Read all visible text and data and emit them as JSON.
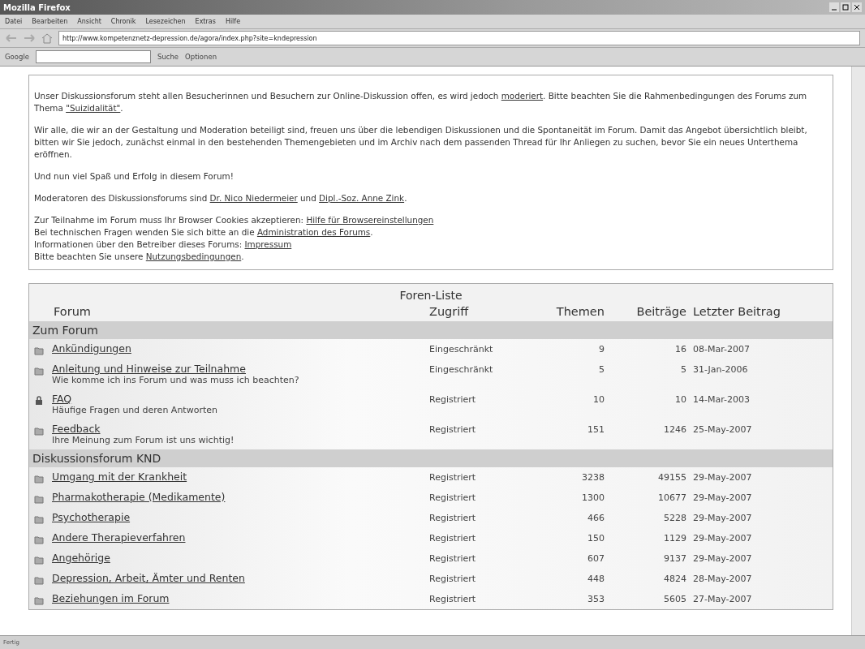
{
  "window": {
    "title": "Mozilla Firefox"
  },
  "menu": [
    "Datei",
    "Bearbeiten",
    "Ansicht",
    "Chronik",
    "Lesezeichen",
    "Extras",
    "Hilfe"
  ],
  "address": {
    "value": "http://www.kompetenznetz-depression.de/agora/index.php?site=kndepression"
  },
  "google_toolbar": {
    "brand": "Google",
    "search": "Suche",
    "options": "Optionen"
  },
  "intro": [
    [
      {
        "kind": "text",
        "text": "Unser Diskussionsforum steht allen Besucherinnen und Besuchern zur Online-Diskussion offen, es wird jedoch "
      },
      {
        "kind": "link",
        "text": "moderiert"
      },
      {
        "kind": "text",
        "text": ". Bitte beachten Sie die Rahmenbedingungen des Forums zum Thema "
      },
      {
        "kind": "link",
        "text": "\"Suizidalität\""
      },
      {
        "kind": "text",
        "text": "."
      }
    ],
    [
      {
        "kind": "text",
        "text": "Wir alle, die wir an der Gestaltung und Moderation beteiligt sind, freuen uns über die lebendigen Diskussionen und die Spontaneität im Forum. Damit das Angebot übersichtlich bleibt, bitten wir Sie jedoch, zunächst einmal in den bestehenden Themengebieten und im Archiv nach dem passenden Thread für Ihr Anliegen zu suchen, bevor Sie ein neues Unterthema eröffnen."
      }
    ],
    [
      {
        "kind": "text",
        "text": "Und nun viel Spaß und Erfolg in diesem Forum!"
      }
    ],
    [
      {
        "kind": "text",
        "text": "Moderatoren des Diskussionsforums sind "
      },
      {
        "kind": "link",
        "text": "Dr. Nico Niedermeier"
      },
      {
        "kind": "text",
        "text": " und "
      },
      {
        "kind": "link",
        "text": "Dipl.-Soz. Anne Zink"
      },
      {
        "kind": "text",
        "text": "."
      }
    ]
  ],
  "info_lines": [
    [
      {
        "kind": "text",
        "text": "Zur Teilnahme im Forum muss Ihr Browser Cookies akzeptieren: "
      },
      {
        "kind": "link",
        "text": "Hilfe für Browsereinstellungen"
      }
    ],
    [
      {
        "kind": "text",
        "text": "Bei technischen Fragen wenden Sie sich bitte an die "
      },
      {
        "kind": "link",
        "text": "Administration des Forums"
      },
      {
        "kind": "text",
        "text": "."
      }
    ],
    [
      {
        "kind": "text",
        "text": "Informationen über den Betreiber dieses Forums: "
      },
      {
        "kind": "link",
        "text": "Impressum"
      }
    ],
    [
      {
        "kind": "text",
        "text": "Bitte beachten Sie unsere "
      },
      {
        "kind": "link",
        "text": "Nutzungsbedingungen"
      },
      {
        "kind": "text",
        "text": "."
      }
    ]
  ],
  "forum_list": {
    "title": "Foren-Liste",
    "columns": [
      "Forum",
      "Zugriff",
      "Themen",
      "Beiträge",
      "Letzter Beitrag"
    ],
    "sections": [
      {
        "title": "Zum Forum",
        "rows": [
          {
            "kind": "folder",
            "name": "Ankündigungen",
            "access": "Eingeschränkt",
            "topics": "9",
            "posts": "16",
            "last": "08-Mar-2007"
          },
          {
            "kind": "folder",
            "name": "Anleitung und Hinweise zur Teilnahme",
            "description": "Wie komme ich ins Forum und was muss ich beachten?",
            "access": "Eingeschränkt",
            "topics": "5",
            "posts": "5",
            "last": "31-Jan-2006"
          },
          {
            "kind": "locked",
            "name": "FAQ",
            "description": "Häufige Fragen und deren Antworten",
            "access": "Registriert",
            "topics": "10",
            "posts": "10",
            "last": "14-Mar-2003"
          },
          {
            "kind": "folder",
            "name": "Feedback",
            "description": "Ihre Meinung zum Forum ist uns wichtig!",
            "access": "Registriert",
            "topics": "151",
            "posts": "1246",
            "last": "25-May-2007"
          }
        ]
      },
      {
        "title": "Diskussionsforum KND",
        "rows": [
          {
            "kind": "folder",
            "name": "Umgang mit der Krankheit",
            "access": "Registriert",
            "topics": "3238",
            "posts": "49155",
            "last": "29-May-2007"
          },
          {
            "kind": "folder",
            "name": "Pharmakotherapie (Medikamente)",
            "access": "Registriert",
            "topics": "1300",
            "posts": "10677",
            "last": "29-May-2007"
          },
          {
            "kind": "folder",
            "name": "Psychotherapie",
            "access": "Registriert",
            "topics": "466",
            "posts": "5228",
            "last": "29-May-2007"
          },
          {
            "kind": "folder",
            "name": "Andere Therapieverfahren",
            "access": "Registriert",
            "topics": "150",
            "posts": "1129",
            "last": "29-May-2007"
          },
          {
            "kind": "folder",
            "name": "Angehörige",
            "access": "Registriert",
            "topics": "607",
            "posts": "9137",
            "last": "29-May-2007"
          },
          {
            "kind": "folder",
            "name": "Depression, Arbeit, Ämter und Renten",
            "access": "Registriert",
            "topics": "448",
            "posts": "4824",
            "last": "28-May-2007"
          },
          {
            "kind": "folder",
            "name": "Beziehungen im Forum",
            "access": "Registriert",
            "topics": "353",
            "posts": "5605",
            "last": "27-May-2007"
          }
        ]
      }
    ]
  },
  "status_bar": {
    "text": "Fertig"
  }
}
